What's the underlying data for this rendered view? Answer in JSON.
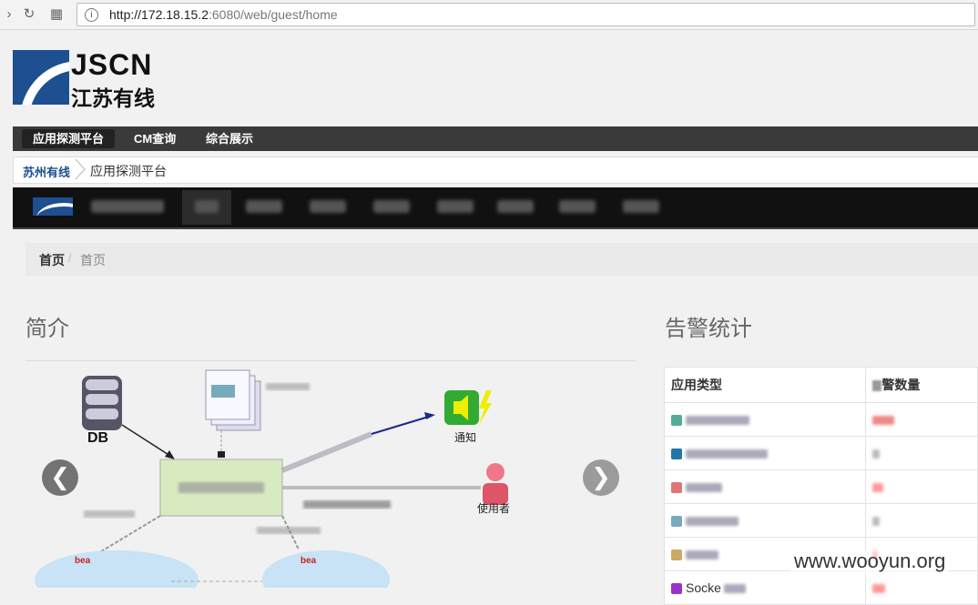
{
  "browser": {
    "url_host": "http://172.18.15.2",
    "url_rest": ":6080/web/guest/home"
  },
  "logo": {
    "en": "JSCN",
    "cn": "江苏有线"
  },
  "top_menu": [
    "应用探测平台",
    "CM查询",
    "综合展示"
  ],
  "breadcrumb_top": {
    "root": "苏州有线",
    "current": "应用探测平台"
  },
  "content_breadcrumb": {
    "home": "首页",
    "sep": "/",
    "current": "首页"
  },
  "sections": {
    "intro_title": "简介",
    "alert_title": "告警统计"
  },
  "diagram": {
    "db_label": "DB",
    "notify_label": "通知",
    "user_label": "使用者",
    "bea_label": "bea"
  },
  "carousel": {
    "prev": "❮",
    "next": "❯"
  },
  "alert_table": {
    "headers": [
      "应用类型",
      "警数量"
    ],
    "rows": [
      {
        "icon_color": "#5a9",
        "label_w": 70,
        "num_color": "#e88",
        "num_w": 24
      },
      {
        "icon_color": "#27a",
        "label_w": 90,
        "num_color": "#bbb",
        "num_w": 8
      },
      {
        "icon_color": "#d77",
        "label_w": 40,
        "num_color": "#f99",
        "num_w": 12
      },
      {
        "icon_color": "#7ab",
        "label_w": 58,
        "num_color": "#bbb",
        "num_w": 8
      },
      {
        "icon_color": "#ca6",
        "label_w": 36,
        "num_color": "#f88",
        "num_w": 6
      },
      {
        "icon_color": "#93c",
        "label_w": 0,
        "num_color": "#f99",
        "num_w": 14,
        "text": "Socke"
      }
    ]
  },
  "watermark": "www.wooyun.org",
  "colors": {
    "brand": "#1d4f91",
    "menubar": "#3a3a3a",
    "appnav": "#111111"
  }
}
